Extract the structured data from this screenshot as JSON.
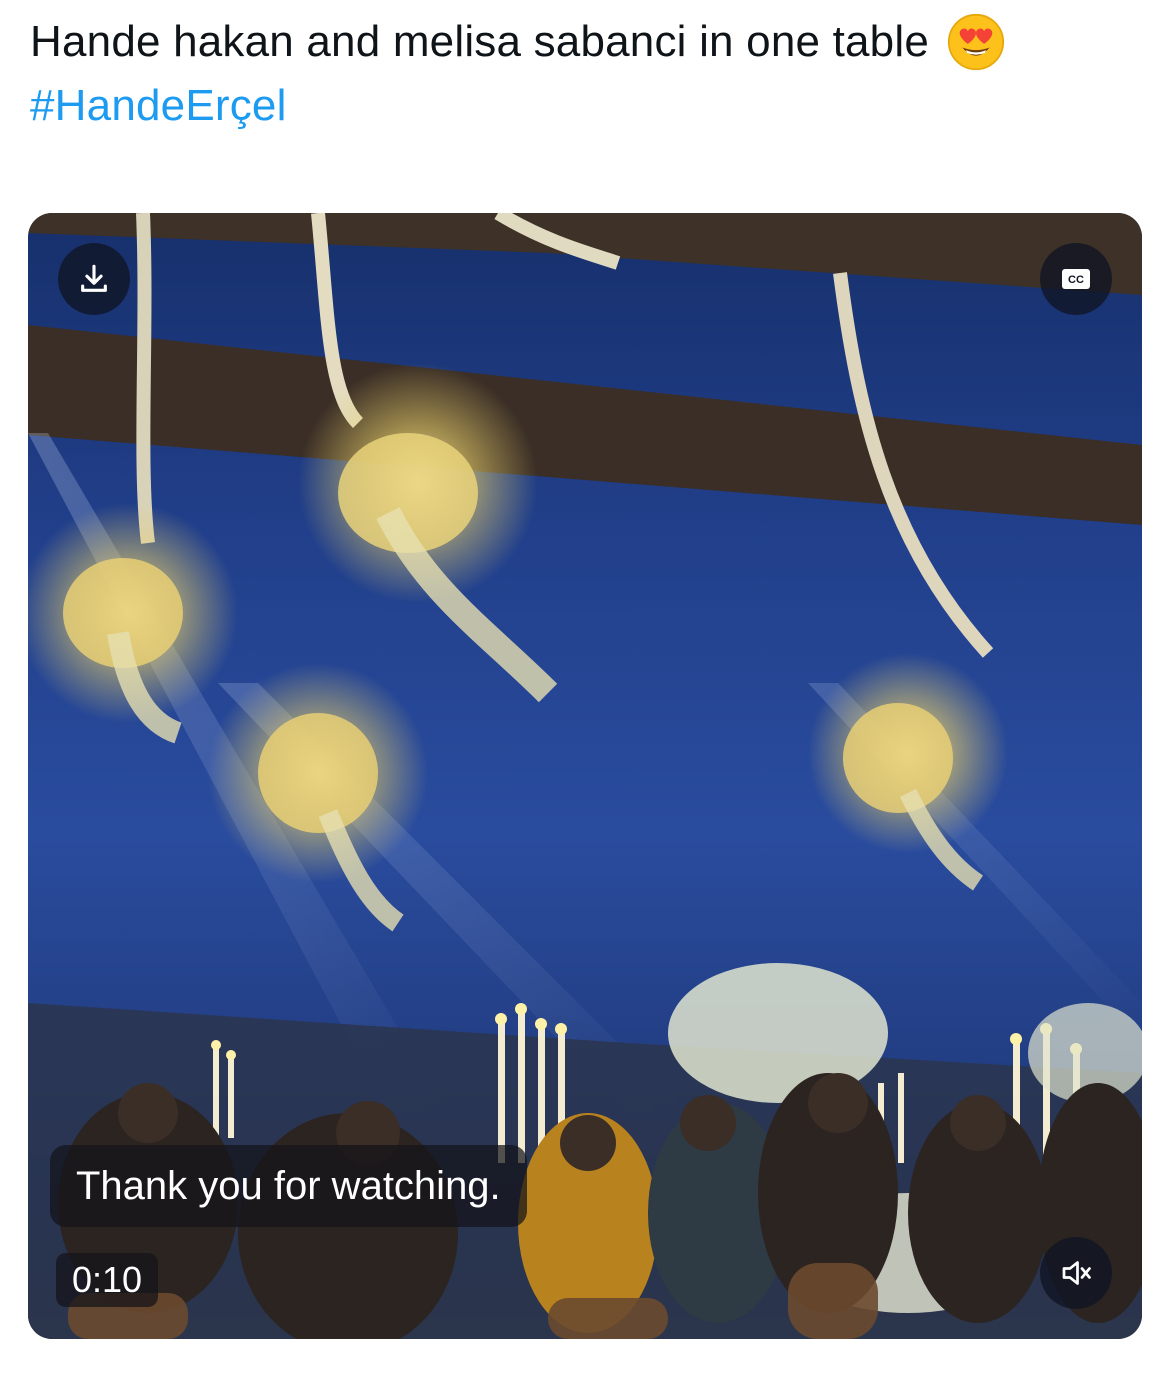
{
  "tweet": {
    "text": "Hande hakan and melisa sabanci in one table",
    "emoji": "smiling-face-with-heart-eyes",
    "hashtag": "#HandeErçel"
  },
  "video": {
    "caption": "Thank you for watching.",
    "elapsed_time": "0:10",
    "download_icon": "download-icon",
    "cc_icon": "closed-captions-icon",
    "cc_label": "CC",
    "mute_icon": "muted-speaker-icon",
    "muted": true
  },
  "colors": {
    "hashtag": "#1d9bf0",
    "text": "#0f1419",
    "overlay": "#0f1423"
  }
}
